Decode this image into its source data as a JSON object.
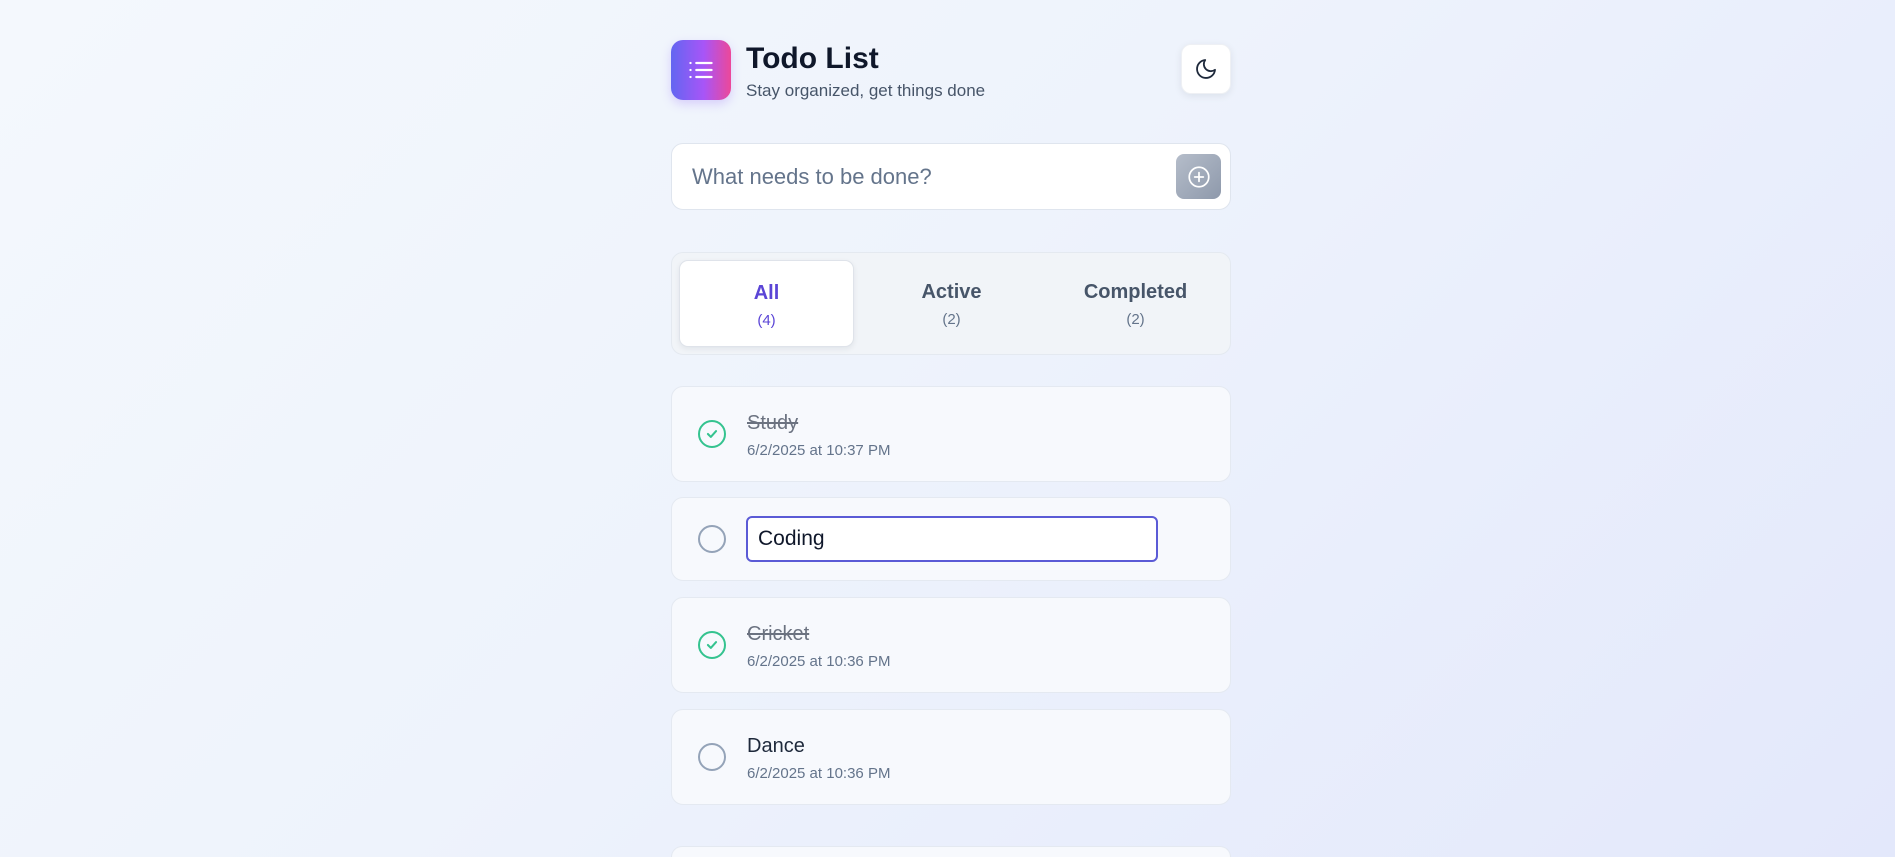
{
  "header": {
    "title": "Todo List",
    "subtitle": "Stay organized, get things done"
  },
  "add_todo": {
    "placeholder": "What needs to be done?",
    "value": ""
  },
  "filters": [
    {
      "label": "All",
      "count": "(4)",
      "active": true
    },
    {
      "label": "Active",
      "count": "(2)",
      "active": false
    },
    {
      "label": "Completed",
      "count": "(2)",
      "active": false
    }
  ],
  "todos": [
    {
      "text": "Study",
      "date": "6/2/2025 at 10:37 PM",
      "completed": true,
      "editing": false
    },
    {
      "text": "Coding",
      "date": "",
      "completed": false,
      "editing": true,
      "edit_value": "Coding"
    },
    {
      "text": "Cricket",
      "date": "6/2/2025 at 10:36 PM",
      "completed": true,
      "editing": false
    },
    {
      "text": "Dance",
      "date": "6/2/2025 at 10:36 PM",
      "completed": false,
      "editing": false
    }
  ],
  "colors": {
    "accent": "#5b45d6",
    "completed_check": "#34c38f",
    "logo_gradient": [
      "#6366f1",
      "#a855f7",
      "#ec4899"
    ]
  },
  "icons": {
    "logo": "list-icon",
    "theme_toggle": "moon-icon",
    "add": "plus-circle-icon",
    "completed": "check-circle-icon"
  }
}
